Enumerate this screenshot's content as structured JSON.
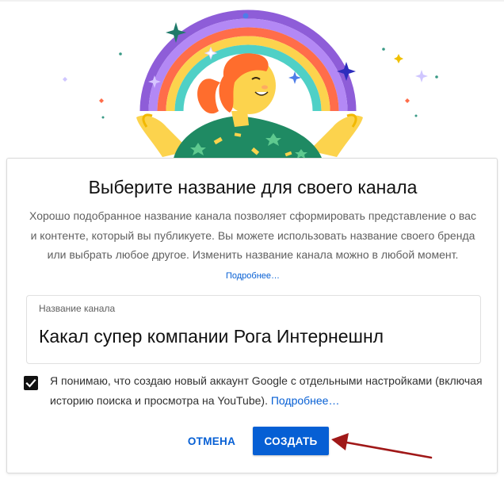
{
  "dialog": {
    "title": "Выберите название для своего канала",
    "description": "Хорошо подобранное название канала позволяет сформировать представление о вас и контенте, который вы публикуете. Вы можете использовать название своего бренда или выбрать любое другое. Изменить название канала можно в любой момент.",
    "description_link": "Подробнее…",
    "channel_name_field": {
      "label": "Название канала",
      "value": "Какал супер компании Рога Интернешнл"
    },
    "agreement": {
      "checked": true,
      "text": "Я понимаю, что создаю новый аккаунт Google с отдельными настройками (включая историю поиска и просмотра на YouTube).",
      "link": "Подробнее…"
    },
    "buttons": {
      "cancel": "ОТМЕНА",
      "create": "СОЗДАТЬ"
    }
  },
  "colors": {
    "accent": "#065fd4",
    "annotation_arrow": "#a01818",
    "rainbow": [
      "#8e5dd8",
      "#b388f5",
      "#ff6d4a",
      "#fcd34d",
      "#4fd0c6",
      "#3a9a86"
    ]
  },
  "icons": {
    "illustration": "rainbow-person-illustration",
    "checkbox": "checkmark-icon",
    "annotation": "annotation-arrow"
  }
}
